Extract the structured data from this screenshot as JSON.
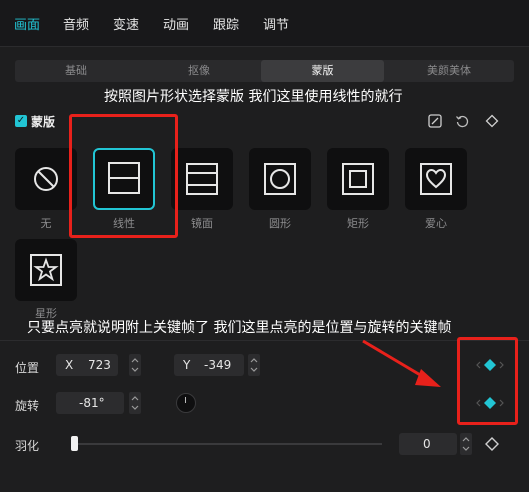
{
  "top_tabs": [
    "画面",
    "音频",
    "变速",
    "动画",
    "跟踪",
    "调节"
  ],
  "sub_tabs": [
    "基础",
    "抠像",
    "蒙版",
    "美颜美体"
  ],
  "annotations": {
    "top": "按照图片形状选择蒙版 我们这里使用线性的就行",
    "middle": "只要点亮就说明附上关键帧了 我们这里点亮的是位置与旋转的关键帧"
  },
  "section": {
    "label": "蒙版",
    "checked": true,
    "check_glyph": "✓"
  },
  "masks": [
    {
      "label": "无",
      "icon": "none-icon"
    },
    {
      "label": "线性",
      "icon": "linear-icon",
      "selected": true
    },
    {
      "label": "镜面",
      "icon": "mirror-icon"
    },
    {
      "label": "圆形",
      "icon": "circle-icon"
    },
    {
      "label": "矩形",
      "icon": "rectangle-icon"
    },
    {
      "label": "爱心",
      "icon": "heart-icon"
    },
    {
      "label": "星形",
      "icon": "star-icon"
    }
  ],
  "position": {
    "label": "位置",
    "x_key": "X",
    "x_value": "723",
    "y_key": "Y",
    "y_value": "-349",
    "keyframe_active": true
  },
  "rotation": {
    "label": "旋转",
    "value": "-81°",
    "keyframe_active": true
  },
  "feather": {
    "label": "羽化",
    "value": "0",
    "level": 0,
    "keyframe_active": false
  },
  "colors": {
    "accent": "#22c5d4",
    "annotation_box": "#e8211b",
    "background": "#1e1e1f"
  }
}
